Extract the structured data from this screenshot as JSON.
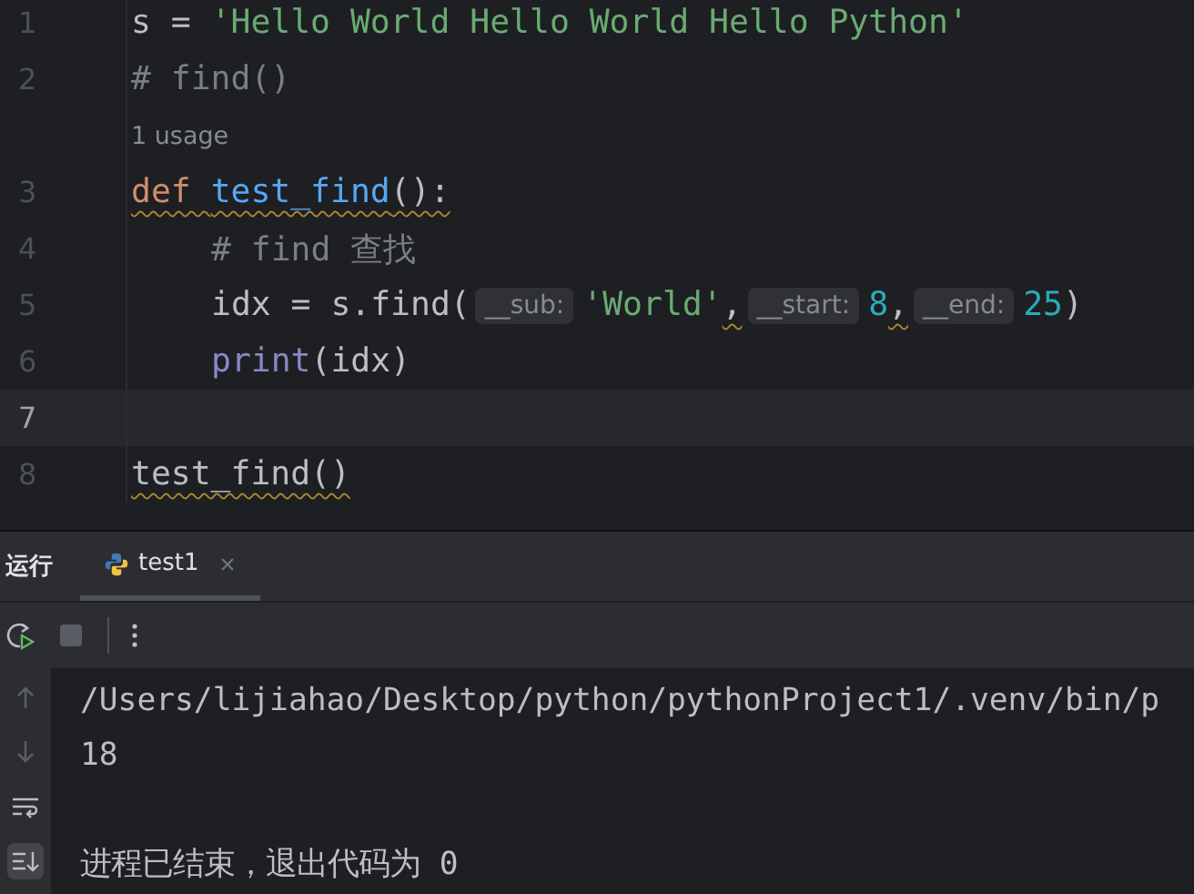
{
  "editor": {
    "lines": [
      {
        "number": "1",
        "current": false,
        "tokens": [
          {
            "kind": "plain",
            "text": "s = "
          },
          {
            "kind": "string",
            "text": "'Hello World Hello World Hello Python'"
          }
        ]
      },
      {
        "number": "2",
        "current": false,
        "tokens": [
          {
            "kind": "comment",
            "text": "# find()"
          }
        ]
      },
      {
        "current": false,
        "usage": "1 usage"
      },
      {
        "number": "3",
        "current": false,
        "tokens": [
          {
            "kind": "keyword",
            "text": "def ",
            "warn": true
          },
          {
            "kind": "func",
            "text": "test_find",
            "warn": true
          },
          {
            "kind": "plain",
            "text": "():",
            "warn": true
          }
        ]
      },
      {
        "number": "4",
        "current": false,
        "indented": true,
        "tokens": [
          {
            "kind": "comment",
            "text": "# find 查找"
          }
        ]
      },
      {
        "number": "5",
        "current": false,
        "indented": true,
        "tokens": [
          {
            "kind": "plain",
            "text": "idx = s.find("
          },
          {
            "kind": "hint",
            "text": "__sub:"
          },
          {
            "kind": "string",
            "text": "'World'"
          },
          {
            "kind": "plain",
            "text": ",",
            "warn": true
          },
          {
            "kind": "hint",
            "text": "__start:"
          },
          {
            "kind": "number",
            "text": "8"
          },
          {
            "kind": "plain",
            "text": ",",
            "warn": true
          },
          {
            "kind": "hint",
            "text": "__end:"
          },
          {
            "kind": "number",
            "text": "25"
          },
          {
            "kind": "plain",
            "text": ")"
          }
        ]
      },
      {
        "number": "6",
        "current": false,
        "indented": true,
        "tokens": [
          {
            "kind": "builtin",
            "text": "print"
          },
          {
            "kind": "plain",
            "text": "(idx)"
          }
        ]
      },
      {
        "number": "7",
        "current": true
      },
      {
        "number": "8",
        "current": false,
        "tokens": [
          {
            "kind": "plain",
            "text": "test_find()",
            "warn": true
          }
        ]
      }
    ]
  },
  "run_panel": {
    "title": "运行",
    "tabs": [
      {
        "label": "test1",
        "selected": true
      }
    ],
    "console_tools": [
      {
        "kind": "up",
        "selected": false
      },
      {
        "kind": "down",
        "selected": false
      },
      {
        "kind": "wrap",
        "selected": false
      },
      {
        "kind": "scroll-end",
        "selected": true
      }
    ],
    "output": [
      {
        "text": "/Users/lijiahao/Desktop/python/pythonProject1/.venv/bin/p",
        "gap_before": false
      },
      {
        "text": "18",
        "gap_before": false
      },
      {
        "text": "进程已结束，退出代码为 0",
        "gap_before": true
      }
    ]
  }
}
